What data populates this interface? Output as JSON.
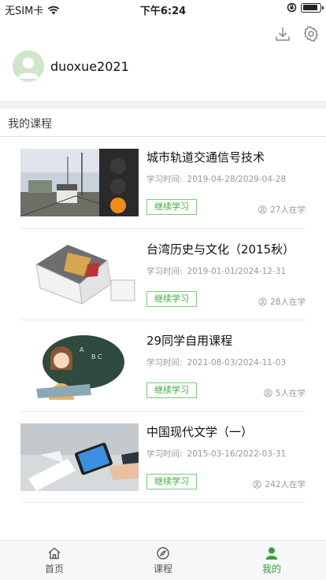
{
  "status_bar": {
    "carrier": "无SIM卡",
    "time": "下午6:24",
    "battery_level": 0.9
  },
  "header": {
    "download_icon": "download-icon",
    "settings_icon": "gear-icon"
  },
  "profile": {
    "username": "duoxue2021",
    "avatar_icon": "user-avatar-icon"
  },
  "section": {
    "title": "我的课程"
  },
  "courses": [
    {
      "title": "城市轨道交通信号技术",
      "time_label": "学习时间:",
      "time_range": "2019-04-28/2029-04-28",
      "button": "继续学习",
      "learners": "27人在学"
    },
    {
      "title": "台湾历史与文化（2015秋）",
      "time_label": "学习时间:",
      "time_range": "2019-01-01/2024-12-31",
      "button": "继续学习",
      "learners": "28人在学"
    },
    {
      "title": "29同学自用课程",
      "time_label": "学习时间:",
      "time_range": "2021-08-03/2024-11-03",
      "button": "继续学习",
      "learners": "5人在学"
    },
    {
      "title": "中国现代文学（一）",
      "time_label": "学习时间:",
      "time_range": "2015-03-16/2022-03-31",
      "button": "继续学习",
      "learners": "242人在学"
    }
  ],
  "tabbar": {
    "items": [
      {
        "label": "首页",
        "icon": "home-icon"
      },
      {
        "label": "课程",
        "icon": "compass-icon"
      },
      {
        "label": "我的",
        "icon": "person-icon"
      }
    ],
    "active_index": 2,
    "active_color": "#2f9f3d"
  }
}
